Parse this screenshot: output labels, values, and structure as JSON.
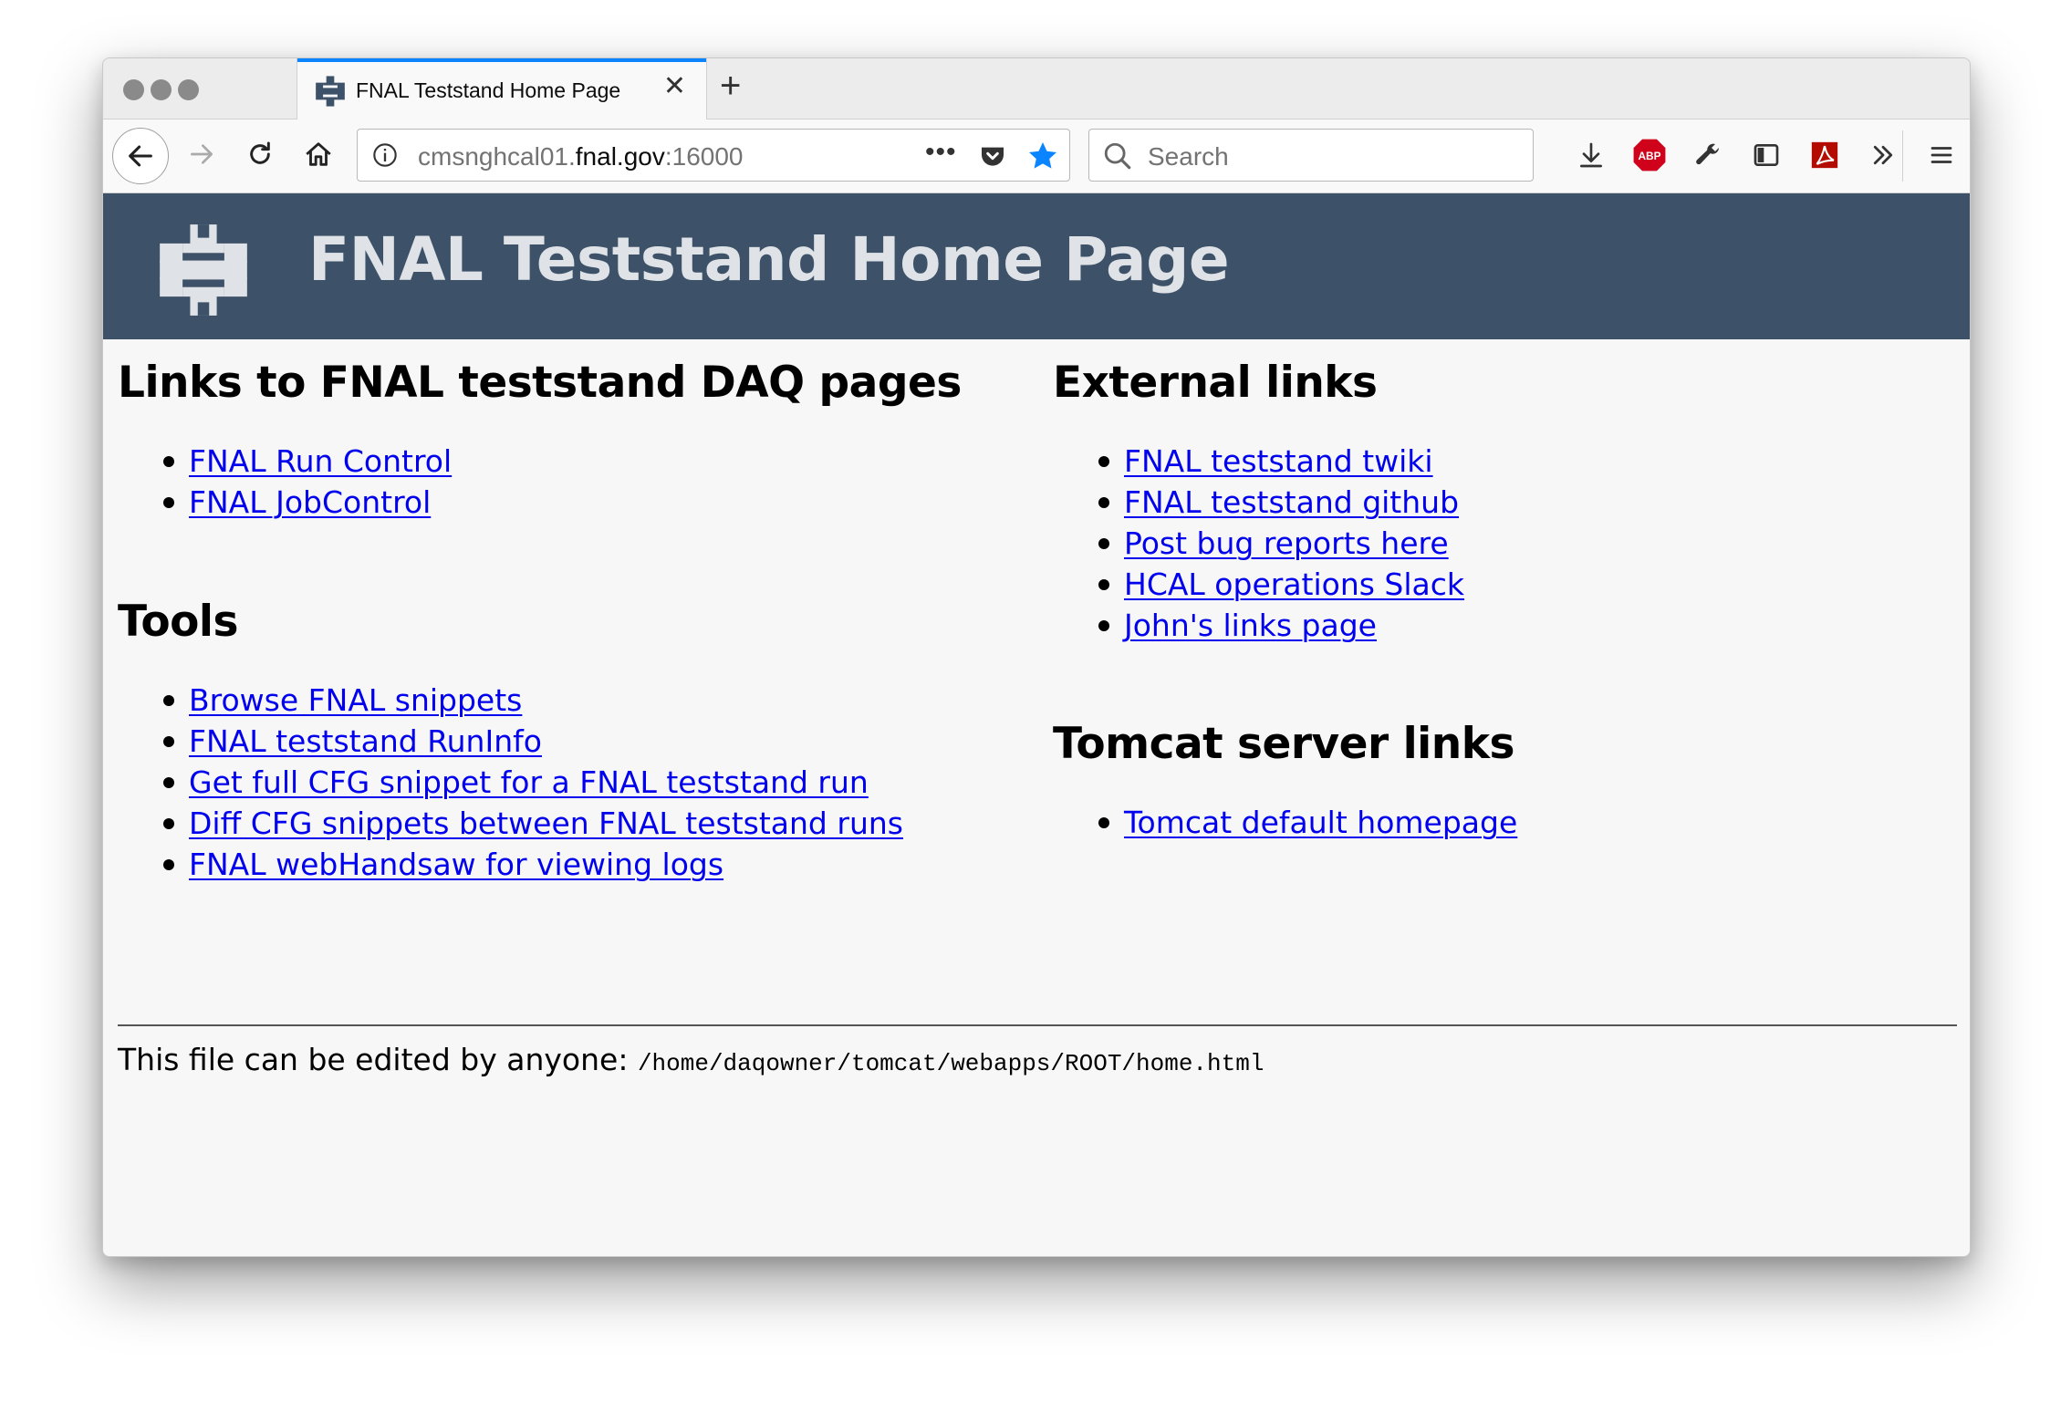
{
  "browser": {
    "tab_title": "FNAL Teststand Home Page",
    "url_prefix": "cmsnghcal01.",
    "url_domain": "fnal.gov",
    "url_suffix": ":16000",
    "search_placeholder": "Search",
    "accent_color": "#0a84ff",
    "toolbar_icons": [
      "download-icon",
      "adblock-plus-icon",
      "wrench-icon",
      "sidebar-icon",
      "acrobat-icon",
      "overflow-menu-icon",
      "hamburger-menu-icon"
    ]
  },
  "header": {
    "title": "FNAL Teststand Home Page",
    "background": "#3d5268",
    "logo": "fermilab-logo"
  },
  "daq": {
    "heading": "Links to FNAL teststand DAQ pages",
    "links": [
      "FNAL Run Control",
      "FNAL JobControl"
    ]
  },
  "tools": {
    "heading": "Tools",
    "links": [
      "Browse FNAL snippets",
      "FNAL teststand RunInfo",
      "Get full CFG snippet for a FNAL teststand run",
      "Diff CFG snippets between FNAL teststand runs",
      "FNAL webHandsaw for viewing logs"
    ]
  },
  "external": {
    "heading": "External links",
    "links": [
      "FNAL teststand twiki",
      "FNAL teststand github",
      "Post bug reports here",
      "HCAL operations Slack",
      "John's links page"
    ]
  },
  "tomcat": {
    "heading": "Tomcat server links",
    "links": [
      "Tomcat default homepage"
    ]
  },
  "footer": {
    "text": "This file can be edited by anyone: ",
    "path": "/home/daqowner/tomcat/webapps/ROOT/home.html"
  }
}
